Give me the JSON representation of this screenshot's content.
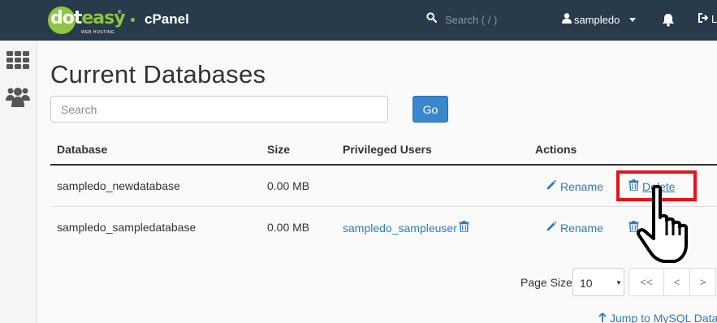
{
  "topbar": {
    "logo": {
      "dot": "dot",
      "easy": "easy",
      "tagline": "WEB HOSTING",
      "tm": "®"
    },
    "brand": "cPanel",
    "search_placeholder": "Search ( / )",
    "username": "sampledo",
    "logout_label": "L"
  },
  "page": {
    "title": "Current Databases",
    "search_placeholder": "Search",
    "go_label": "Go"
  },
  "table": {
    "headers": [
      "Database",
      "Size",
      "Privileged Users",
      "Actions"
    ],
    "rows": [
      {
        "database": "sampledo_newdatabase",
        "size": "0.00 MB",
        "privileged_user": "",
        "rename": "Rename",
        "delete": "Delete"
      },
      {
        "database": "sampledo_sampledatabase",
        "size": "0.00 MB",
        "privileged_user": "sampledo_sampleuser",
        "rename": "Rename",
        "delete": ""
      }
    ]
  },
  "pagination": {
    "page_size_label": "Page Size",
    "page_size_value": "10",
    "first": "<<",
    "prev": "<",
    "next": ">"
  },
  "jump_link": "Jump to MySQL Data",
  "colors": {
    "topbar": "#293a4a",
    "brand_green": "#8dc63f",
    "link_blue": "#337ab7",
    "highlight_red": "#e4141b",
    "button_blue": "#3a87cd"
  },
  "icons": {
    "search": "search-icon",
    "user": "user-icon",
    "bell": "bell-icon",
    "logout": "logout-icon",
    "apps": "grid-icon",
    "users": "users-icon",
    "rename": "pencil-icon",
    "delete": "trash-icon",
    "cursor": "hand-pointer-icon",
    "jump": "arrow-up-icon"
  }
}
